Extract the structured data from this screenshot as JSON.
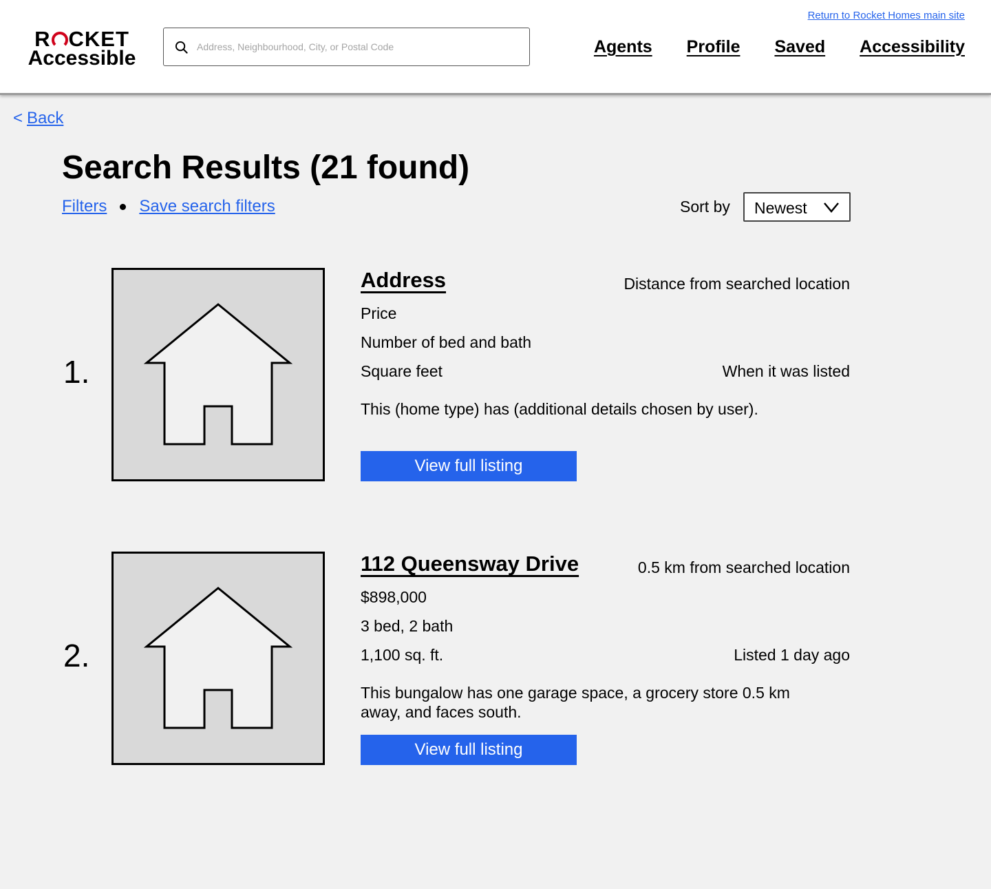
{
  "header": {
    "logo_top_left": "R",
    "logo_top_right": "CKET",
    "logo_bottom": "Accessible",
    "search_placeholder": "Address, Neighbourhood, City, or Postal Code",
    "return_link": "Return to Rocket Homes main site",
    "nav": [
      "Agents",
      "Profile",
      "Saved",
      "Accessibility"
    ]
  },
  "page": {
    "back_glyph": "<",
    "back_label": "Back",
    "title": "Search Results (21 found)",
    "filters_link": "Filters",
    "save_filters_link": "Save search filters",
    "sort_label": "Sort by",
    "sort_value": "Newest"
  },
  "listings": [
    {
      "rank": "1.",
      "address": "Address",
      "distance": "Distance from searched location",
      "price": "Price",
      "beds_baths": "Number of bed and bath",
      "sqft": "Square feet",
      "listed": "When it was listed",
      "description": "This (home type) has (additional details chosen by user).",
      "button": "View full listing"
    },
    {
      "rank": "2.",
      "address": "112 Queensway Drive",
      "distance": "0.5 km from searched location",
      "price": "$898,000",
      "beds_baths": "3 bed, 2 bath",
      "sqft": "1,100 sq. ft.",
      "listed": "Listed 1 day ago",
      "description": "This bungalow has one garage space, a grocery store 0.5 km away, and faces south.",
      "button": "View full listing"
    }
  ],
  "colors": {
    "accent": "#2563eb",
    "brand_red": "#d0021b",
    "background": "#f1f1f1",
    "thumbnail": "#d9d9d9"
  },
  "icons": [
    "search-icon",
    "chevron-down-icon",
    "house-icon"
  ]
}
